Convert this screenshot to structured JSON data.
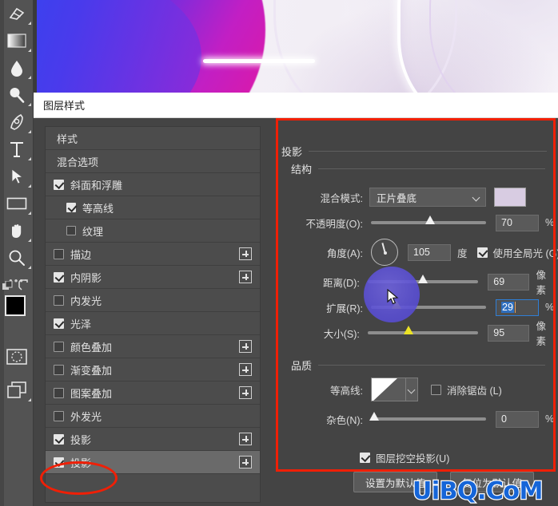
{
  "toolbar": {
    "tools": [
      {
        "name": "eraser-tool",
        "icon": "eraser-icon"
      },
      {
        "name": "gradient-tool",
        "icon": "gradient-icon"
      },
      {
        "name": "blur-tool",
        "icon": "droplet-icon"
      },
      {
        "name": "dodge-tool",
        "icon": "dodge-icon"
      },
      {
        "name": "pen-tool",
        "icon": "pen-icon"
      },
      {
        "name": "type-tool",
        "icon": "type-icon"
      },
      {
        "name": "path-selection-tool",
        "icon": "arrow-pointer-icon"
      },
      {
        "name": "rectangle-tool",
        "icon": "rectangle-icon"
      },
      {
        "name": "hand-tool",
        "icon": "hand-icon"
      },
      {
        "name": "zoom-tool",
        "icon": "magnifier-icon"
      }
    ],
    "more_tools_label": "•••",
    "foreground_color": "#000000",
    "background_color": "#f0eef2",
    "quick_mask_name": "quick-mask-icon",
    "screen_mode_name": "screen-mode-icon"
  },
  "dialog": {
    "title": "图层样式"
  },
  "style_list": [
    {
      "label": "样式",
      "type": "plain",
      "checkbox": null,
      "plus": false,
      "selected": false
    },
    {
      "label": "混合选项",
      "type": "plain",
      "checkbox": null,
      "plus": false,
      "selected": false
    },
    {
      "label": "斜面和浮雕",
      "type": "normal",
      "checkbox": true,
      "plus": false,
      "selected": false
    },
    {
      "label": "等高线",
      "type": "sub",
      "checkbox": true,
      "plus": false,
      "selected": false
    },
    {
      "label": "纹理",
      "type": "sub",
      "checkbox": false,
      "plus": false,
      "selected": false
    },
    {
      "label": "描边",
      "type": "normal",
      "checkbox": false,
      "plus": true,
      "selected": false
    },
    {
      "label": "内阴影",
      "type": "normal",
      "checkbox": true,
      "plus": true,
      "selected": false
    },
    {
      "label": "内发光",
      "type": "normal",
      "checkbox": false,
      "plus": false,
      "selected": false
    },
    {
      "label": "光泽",
      "type": "normal",
      "checkbox": true,
      "plus": false,
      "selected": false
    },
    {
      "label": "颜色叠加",
      "type": "normal",
      "checkbox": false,
      "plus": true,
      "selected": false
    },
    {
      "label": "渐变叠加",
      "type": "normal",
      "checkbox": false,
      "plus": true,
      "selected": false
    },
    {
      "label": "图案叠加",
      "type": "normal",
      "checkbox": false,
      "plus": true,
      "selected": false
    },
    {
      "label": "外发光",
      "type": "normal",
      "checkbox": false,
      "plus": false,
      "selected": false
    },
    {
      "label": "投影",
      "type": "normal",
      "checkbox": true,
      "plus": true,
      "selected": false
    },
    {
      "label": "投影",
      "type": "normal",
      "checkbox": true,
      "plus": true,
      "selected": true
    }
  ],
  "options": {
    "section_title": "投影",
    "structure_title": "结构",
    "quality_title": "品质",
    "blend_mode_label": "混合模式:",
    "blend_mode_value": "正片叠底",
    "blend_color": "#d8cce2",
    "opacity_label": "不透明度(O):",
    "opacity_value": "70",
    "opacity_unit": "%",
    "angle_label": "角度(A):",
    "angle_value": "105",
    "angle_unit": "度",
    "global_light_label": "使用全局光 (G)",
    "global_light_checked": true,
    "distance_label": "距离(D):",
    "distance_value": "69",
    "distance_unit": "像素",
    "spread_label": "扩展(R):",
    "spread_value": "29",
    "spread_unit": "%",
    "size_label": "大小(S):",
    "size_value": "95",
    "size_unit": "像素",
    "contour_label": "等高线:",
    "antialias_label": "消除锯齿 (L)",
    "antialias_checked": false,
    "noise_label": "杂色(N):",
    "noise_value": "0",
    "noise_unit": "%",
    "knockout_label": "图层挖空投影(U)",
    "knockout_checked": true,
    "set_default_label": "设置为默认值",
    "reset_default_label": "复位为默认值"
  },
  "annotations": {
    "watermark": "UiBQ.CoM",
    "highlight_color": "#f01f06"
  }
}
